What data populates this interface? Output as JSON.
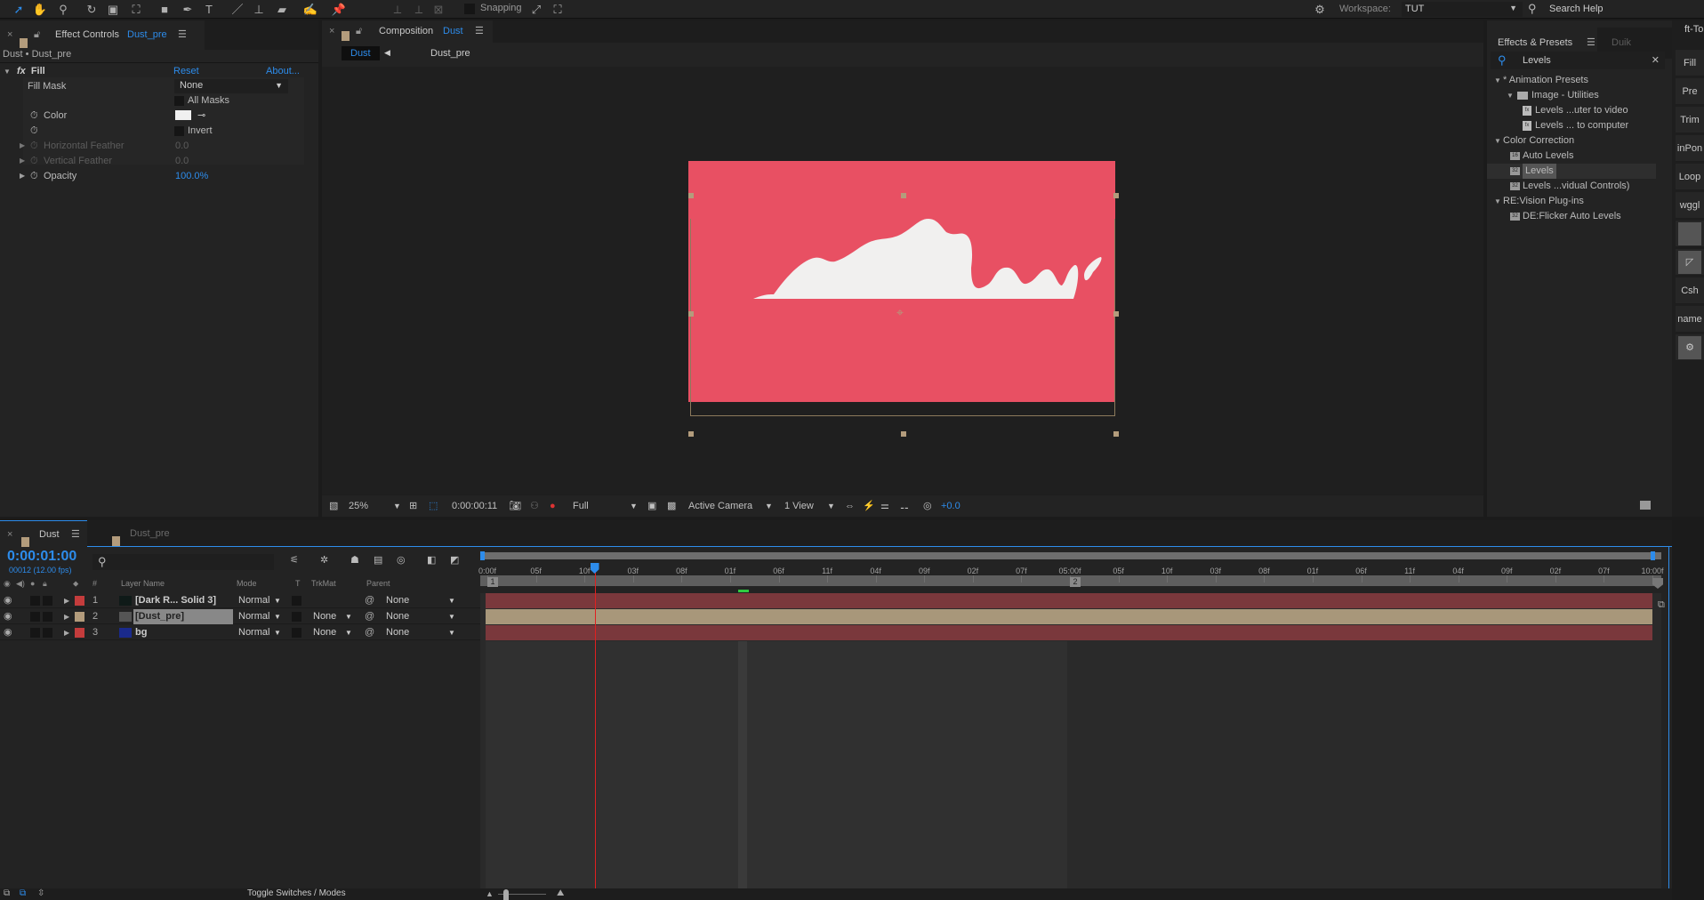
{
  "toolbar": {
    "tools": [
      "selection-tool",
      "hand-tool",
      "zoom-tool",
      "rotate-tool",
      "camera-tool",
      "pan-behind-tool",
      "shape-tool",
      "pen-tool",
      "type-tool",
      "brush-tool",
      "clone-stamp-tool",
      "eraser-tool",
      "roto-brush-tool",
      "puppet-pin-tool"
    ],
    "snapping_label": "Snapping",
    "workspace_label": "Workspace:",
    "workspace_value": "TUT",
    "search_help": "Search Help"
  },
  "effect_controls": {
    "tab_label": "Effect Controls",
    "tab_layer": "Dust_pre",
    "breadcrumb": "Dust • Dust_pre",
    "effect_name": "Fill",
    "reset": "Reset",
    "about": "About...",
    "params": {
      "fill_mask_label": "Fill Mask",
      "fill_mask_value": "None",
      "all_masks_label": "All Masks",
      "color_label": "Color",
      "color_value": "#f0f0f0",
      "invert_label": "Invert",
      "h_feather_label": "Horizontal Feather",
      "h_feather_value": "0.0",
      "v_feather_label": "Vertical Feather",
      "v_feather_value": "0.0",
      "opacity_label": "Opacity",
      "opacity_value": "100.0%"
    }
  },
  "composition": {
    "tab_label": "Composition",
    "tab_comp": "Dust",
    "flow": [
      "Dust",
      "Dust_pre"
    ],
    "canvas_color": "#e85063",
    "bottom": {
      "zoom": "25%",
      "timecode": "0:00:00:11",
      "resolution": "Full",
      "camera": "Active Camera",
      "views": "1 View",
      "exposure": "+0.0"
    }
  },
  "effects_presets": {
    "tab_label": "Effects & Presets",
    "tab2_label": "Duik",
    "search_value": "Levels",
    "tree": [
      {
        "level": 0,
        "type": "group",
        "label": "* Animation Presets"
      },
      {
        "level": 1,
        "type": "folder",
        "label": "Image - Utilities"
      },
      {
        "level": 2,
        "type": "preset",
        "label": "Levels ...uter to video"
      },
      {
        "level": 2,
        "type": "preset",
        "label": "Levels ... to computer"
      },
      {
        "level": 0,
        "type": "group",
        "label": "Color Correction"
      },
      {
        "level": 1,
        "type": "effect16",
        "label": "Auto Levels"
      },
      {
        "level": 1,
        "type": "effect32",
        "label": "Levels",
        "selected": true
      },
      {
        "level": 1,
        "type": "effect32",
        "label": "Levels ...vidual Controls)"
      },
      {
        "level": 0,
        "type": "group",
        "label": "RE:Vision Plug-ins"
      },
      {
        "level": 1,
        "type": "effect32",
        "label": "DE:Flicker Auto Levels"
      }
    ]
  },
  "side_panel": {
    "header": "ft-To",
    "buttons": [
      "Fill",
      "Pre",
      "Trim",
      "inPon",
      "Loop",
      "wggl",
      "",
      "",
      "Csh",
      "name",
      ""
    ]
  },
  "timeline": {
    "tabs": [
      "Dust",
      "Dust_pre"
    ],
    "timecode": "0:00:01:00",
    "frame_info": "00012 (12.00 fps)",
    "columns": {
      "layer_name": "Layer Name",
      "mode": "Mode",
      "t": "T",
      "trkmat": "TrkMat",
      "parent": "Parent",
      "num": "#"
    },
    "layers": [
      {
        "num": "1",
        "name": "[Dark R... Solid 3]",
        "mode": "Normal",
        "trkmat": "",
        "parent": "None",
        "label_color": "#c43c3c",
        "thumb_color": "#0f1a18"
      },
      {
        "num": "2",
        "name": "[Dust_pre]",
        "mode": "Normal",
        "trkmat": "None",
        "parent": "None",
        "label_color": "#b39c7c",
        "thumb_color": "#555555",
        "selected": true
      },
      {
        "num": "3",
        "name": "bg",
        "mode": "Normal",
        "trkmat": "None",
        "parent": "None",
        "label_color": "#c43c3c",
        "thumb_color": "#1a2a8c"
      }
    ],
    "ruler_ticks": [
      "0:00f",
      "05f",
      "10f",
      "03f",
      "08f",
      "01f",
      "06f",
      "11f",
      "04f",
      "09f",
      "02f",
      "07f",
      "05:00f",
      "05f",
      "10f",
      "03f",
      "08f",
      "01f",
      "06f",
      "11f",
      "04f",
      "09f",
      "02f",
      "07f",
      "10:00f"
    ],
    "markers": [
      "1",
      "2"
    ],
    "playhead_fraction": 0.092,
    "toggle_label": "Toggle Switches / Modes"
  }
}
